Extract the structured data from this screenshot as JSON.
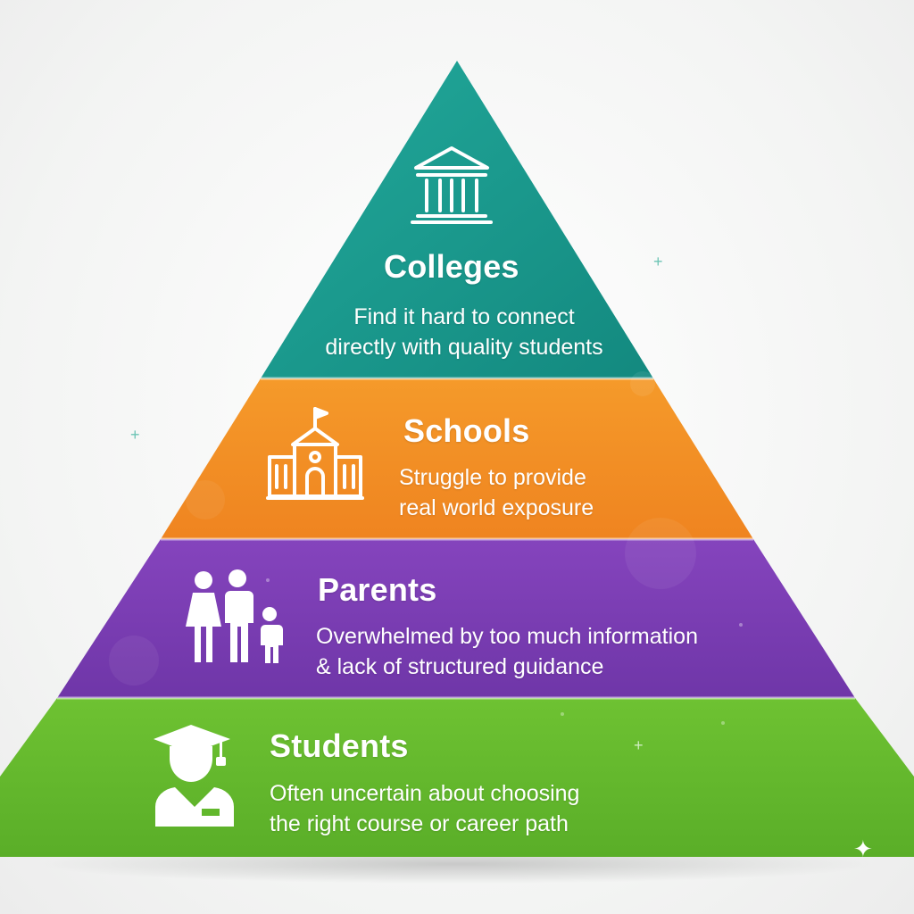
{
  "colors": {
    "colleges": "#1b9a8f",
    "schools": "#f2871f",
    "parents": "#7c3fb2",
    "students": "#62b82c",
    "text": "#ffffff"
  },
  "layers": [
    {
      "key": "colleges",
      "icon": "building-columns-icon",
      "title": "Colleges",
      "desc_line1": "Find it hard to connect",
      "desc_line2": "directly with quality students"
    },
    {
      "key": "schools",
      "icon": "school-building-icon",
      "title": "Schools",
      "desc_line1": "Struggle to provide",
      "desc_line2": "real world exposure"
    },
    {
      "key": "parents",
      "icon": "family-icon",
      "title": "Parents",
      "desc_line1": "Overwhelmed by too much information",
      "desc_line2": "& lack of structured guidance"
    },
    {
      "key": "students",
      "icon": "graduate-student-icon",
      "title": "Students",
      "desc_line1": "Often uncertain about choosing",
      "desc_line2": "the right course or career path"
    }
  ]
}
